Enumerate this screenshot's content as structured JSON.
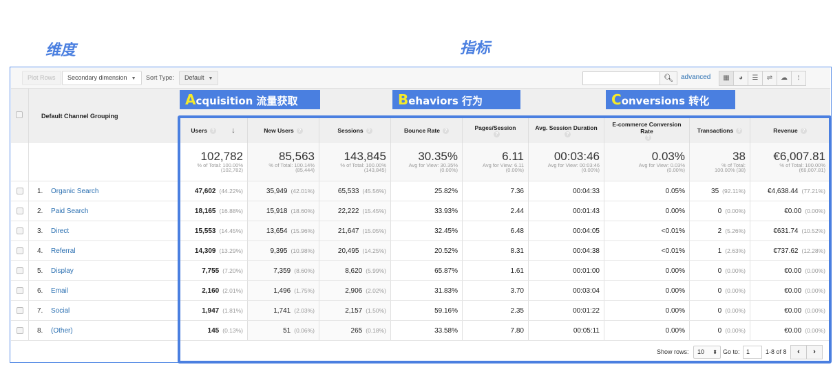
{
  "annotations": {
    "dimension_label": "维度",
    "metrics_label": "指标",
    "groups": [
      {
        "cap": "A",
        "rest": "cquisition 流量获取"
      },
      {
        "cap": "B",
        "rest": "ehaviors 行为"
      },
      {
        "cap": "C",
        "rest": "onversions 转化"
      }
    ],
    "accent_color": "#4a7fe0",
    "cap_color": "#f5ea2a"
  },
  "toolbar": {
    "plot_rows": "Plot Rows",
    "secondary_dimension": "Secondary dimension",
    "sort_type_label": "Sort Type:",
    "sort_type_value": "Default",
    "search_placeholder": "",
    "advanced": "advanced",
    "view_icons": [
      "table-view-icon",
      "pie-view-icon",
      "performance-view-icon",
      "comparison-view-icon",
      "term-cloud-icon",
      "pivot-view-icon"
    ]
  },
  "table": {
    "dimension_header": "Default Channel Grouping",
    "columns": [
      {
        "label": "Users",
        "help": true,
        "sorted": true
      },
      {
        "label": "New Users",
        "help": true
      },
      {
        "label": "Sessions",
        "help": true
      },
      {
        "label": "Bounce Rate",
        "help": true
      },
      {
        "label": "Pages/Session",
        "help": true
      },
      {
        "label": "Avg. Session Duration",
        "help": true
      },
      {
        "label": "E-commerce Conversion Rate",
        "help": true
      },
      {
        "label": "Transactions",
        "help": true
      },
      {
        "label": "Revenue",
        "help": true
      }
    ],
    "totals": [
      {
        "value": "102,782",
        "sub1": "% of Total: 100.00%",
        "sub2": "(102,782)"
      },
      {
        "value": "85,563",
        "sub1": "% of Total: 100.14%",
        "sub2": "(85,444)"
      },
      {
        "value": "143,845",
        "sub1": "% of Total: 100.00%",
        "sub2": "(143,845)"
      },
      {
        "value": "30.35%",
        "sub1": "Avg for View: 30.35%",
        "sub2": "(0.00%)"
      },
      {
        "value": "6.11",
        "sub1": "Avg for View: 6.11",
        "sub2": "(0.00%)"
      },
      {
        "value": "00:03:46",
        "sub1": "Avg for View: 00:03:46",
        "sub2": "(0.00%)"
      },
      {
        "value": "0.03%",
        "sub1": "Avg for View: 0.03%",
        "sub2": "(0.00%)"
      },
      {
        "value": "38",
        "sub1": "% of Total:",
        "sub2": "100.00% (38)"
      },
      {
        "value": "€6,007.81",
        "sub1": "% of Total: 100.00%",
        "sub2": "(€6,007.81)"
      }
    ],
    "rows": [
      {
        "num": "1.",
        "channel": "Organic Search",
        "cells": [
          [
            "47,602",
            "(44.22%)"
          ],
          [
            "35,949",
            "(42.01%)"
          ],
          [
            "65,533",
            "(45.56%)"
          ],
          [
            "25.82%",
            ""
          ],
          [
            "7.36",
            ""
          ],
          [
            "00:04:33",
            ""
          ],
          [
            "0.05%",
            ""
          ],
          [
            "35",
            "(92.11%)"
          ],
          [
            "€4,638.44",
            "(77.21%)"
          ]
        ]
      },
      {
        "num": "2.",
        "channel": "Paid Search",
        "cells": [
          [
            "18,165",
            "(16.88%)"
          ],
          [
            "15,918",
            "(18.60%)"
          ],
          [
            "22,222",
            "(15.45%)"
          ],
          [
            "33.93%",
            ""
          ],
          [
            "2.44",
            ""
          ],
          [
            "00:01:43",
            ""
          ],
          [
            "0.00%",
            ""
          ],
          [
            "0",
            "(0.00%)"
          ],
          [
            "€0.00",
            "(0.00%)"
          ]
        ]
      },
      {
        "num": "3.",
        "channel": "Direct",
        "cells": [
          [
            "15,553",
            "(14.45%)"
          ],
          [
            "13,654",
            "(15.96%)"
          ],
          [
            "21,647",
            "(15.05%)"
          ],
          [
            "32.45%",
            ""
          ],
          [
            "6.48",
            ""
          ],
          [
            "00:04:05",
            ""
          ],
          [
            "<0.01%",
            ""
          ],
          [
            "2",
            "(5.26%)"
          ],
          [
            "€631.74",
            "(10.52%)"
          ]
        ]
      },
      {
        "num": "4.",
        "channel": "Referral",
        "cells": [
          [
            "14,309",
            "(13.29%)"
          ],
          [
            "9,395",
            "(10.98%)"
          ],
          [
            "20,495",
            "(14.25%)"
          ],
          [
            "20.52%",
            ""
          ],
          [
            "8.31",
            ""
          ],
          [
            "00:04:38",
            ""
          ],
          [
            "<0.01%",
            ""
          ],
          [
            "1",
            "(2.63%)"
          ],
          [
            "€737.62",
            "(12.28%)"
          ]
        ]
      },
      {
        "num": "5.",
        "channel": "Display",
        "cells": [
          [
            "7,755",
            "(7.20%)"
          ],
          [
            "7,359",
            "(8.60%)"
          ],
          [
            "8,620",
            "(5.99%)"
          ],
          [
            "65.87%",
            ""
          ],
          [
            "1.61",
            ""
          ],
          [
            "00:01:00",
            ""
          ],
          [
            "0.00%",
            ""
          ],
          [
            "0",
            "(0.00%)"
          ],
          [
            "€0.00",
            "(0.00%)"
          ]
        ]
      },
      {
        "num": "6.",
        "channel": "Email",
        "cells": [
          [
            "2,160",
            "(2.01%)"
          ],
          [
            "1,496",
            "(1.75%)"
          ],
          [
            "2,906",
            "(2.02%)"
          ],
          [
            "31.83%",
            ""
          ],
          [
            "3.70",
            ""
          ],
          [
            "00:03:04",
            ""
          ],
          [
            "0.00%",
            ""
          ],
          [
            "0",
            "(0.00%)"
          ],
          [
            "€0.00",
            "(0.00%)"
          ]
        ]
      },
      {
        "num": "7.",
        "channel": "Social",
        "cells": [
          [
            "1,947",
            "(1.81%)"
          ],
          [
            "1,741",
            "(2.03%)"
          ],
          [
            "2,157",
            "(1.50%)"
          ],
          [
            "59.16%",
            ""
          ],
          [
            "2.35",
            ""
          ],
          [
            "00:01:22",
            ""
          ],
          [
            "0.00%",
            ""
          ],
          [
            "0",
            "(0.00%)"
          ],
          [
            "€0.00",
            "(0.00%)"
          ]
        ]
      },
      {
        "num": "8.",
        "channel": "(Other)",
        "cells": [
          [
            "145",
            "(0.13%)"
          ],
          [
            "51",
            "(0.06%)"
          ],
          [
            "265",
            "(0.18%)"
          ],
          [
            "33.58%",
            ""
          ],
          [
            "7.80",
            ""
          ],
          [
            "00:05:11",
            ""
          ],
          [
            "0.00%",
            ""
          ],
          [
            "0",
            "(0.00%)"
          ],
          [
            "€0.00",
            "(0.00%)"
          ]
        ]
      }
    ]
  },
  "footer": {
    "show_rows_label": "Show rows:",
    "show_rows_value": "10",
    "goto_label": "Go to:",
    "goto_value": "1",
    "page_range": "1-8 of 8",
    "prev": "‹",
    "next": "›"
  }
}
